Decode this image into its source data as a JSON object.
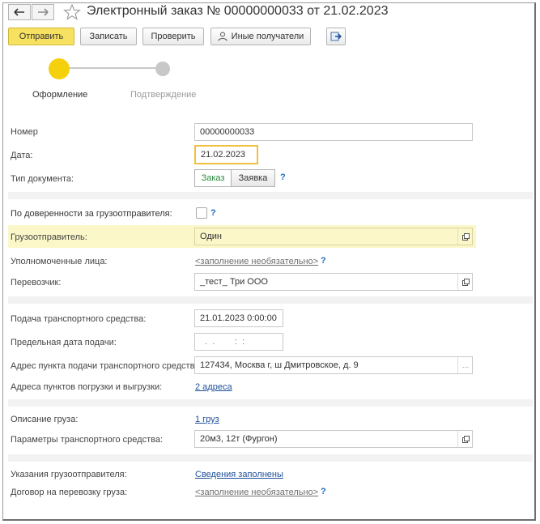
{
  "window": {
    "title": "Электронный заказ № 00000000033 от 21.02.2023"
  },
  "toolbar": {
    "send": "Отправить",
    "save": "Записать",
    "check": "Проверить",
    "other_recipients": "Иные получатели"
  },
  "steps": [
    {
      "label": "Оформление",
      "active": true
    },
    {
      "label": "Подтверждение",
      "active": false
    }
  ],
  "form": {
    "number": {
      "label": "Номер",
      "value": "00000000033"
    },
    "date": {
      "label": "Дата:",
      "value": "21.02.2023"
    },
    "doc_type": {
      "label": "Тип документа:",
      "options": [
        "Заказ",
        "Заявка"
      ],
      "selected": "Заказ",
      "help": "?"
    },
    "by_proxy": {
      "label": "По доверенности за грузоотправителя:",
      "checked": false,
      "help": "?"
    },
    "shipper": {
      "label": "Грузоотправитель:",
      "value": "Один"
    },
    "authorized": {
      "label": "Уполномоченные лица:",
      "value": "<заполнение необязательно>",
      "help": "?"
    },
    "carrier": {
      "label": "Перевозчик:",
      "value": "_тест_ Три ООО"
    },
    "vehicle_supply": {
      "label": "Подача транспортного средства:",
      "value": "21.01.2023  0:00:00"
    },
    "supply_deadline": {
      "label": "Предельная дата подачи:",
      "value": "  .  .        :  :"
    },
    "supply_address": {
      "label": "Адрес пункта подачи транспортного средства:",
      "value": "127434, Москва г, ш Дмитровское, д. 9"
    },
    "load_addresses": {
      "label": "Адреса пунктов погрузки и выгрузки:",
      "value": "2 адреса"
    },
    "cargo_desc": {
      "label": "Описание груза:",
      "value": "1 груз"
    },
    "vehicle_params": {
      "label": "Параметры транспортного средства:",
      "value": "20м3, 12т (Фургон)"
    },
    "shipper_instructions": {
      "label": "Указания грузоотправителя:",
      "value": "Сведения заполнены"
    },
    "contract": {
      "label": "Договор на перевозку груза:",
      "value": "<заполнение необязательно>",
      "help": "?"
    }
  },
  "colors": {
    "accent": "#f6e160",
    "highlight_row": "#fbf7c9",
    "link": "#1d4f9a",
    "step_active": "#f5d10d",
    "step_inactive": "#c8c8c8"
  }
}
